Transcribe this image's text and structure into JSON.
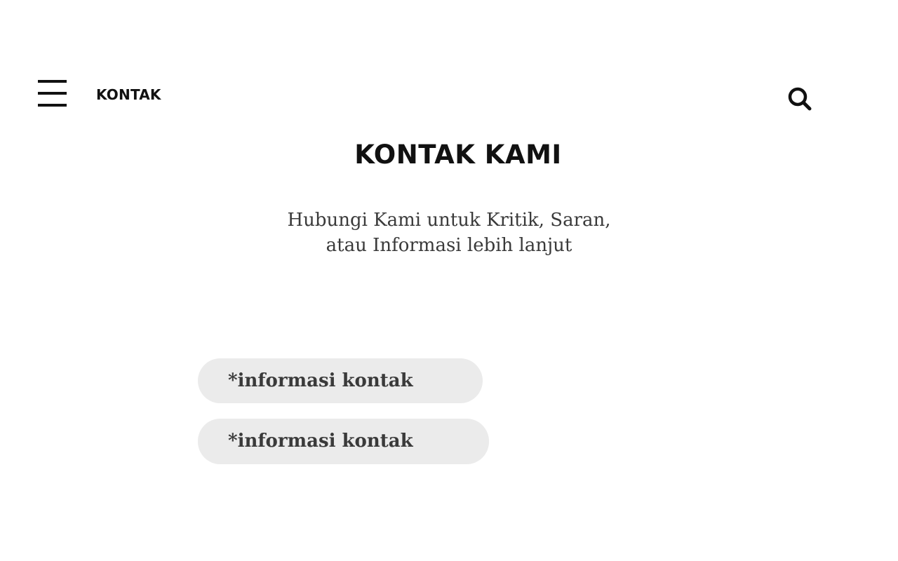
{
  "nav": {
    "title": "KONTAK"
  },
  "icons": {
    "menu": "hamburger-menu-icon",
    "search": "search-icon"
  },
  "heading": {
    "title": "KONTAK KAMI",
    "subtitle_line1": "Hubungi Kami untuk Kritik, Saran,",
    "subtitle_line2": "atau Informasi lebih lanjut"
  },
  "contacts": [
    {
      "label": "*informasi kontak"
    },
    {
      "label": "*informasi kontak"
    }
  ],
  "colors": {
    "background": "#ffffff",
    "text_primary": "#111111",
    "text_secondary": "#3a3a3a",
    "pill_background": "#ebebeb"
  }
}
